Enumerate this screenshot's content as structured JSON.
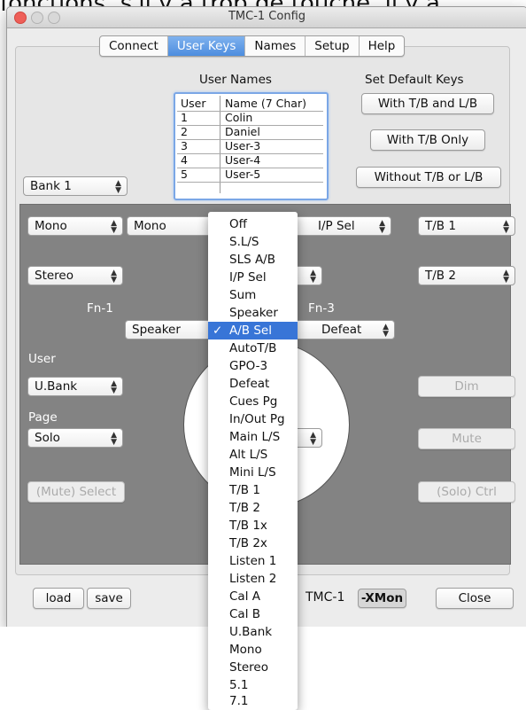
{
  "top_text": "fonctions, s'il y a trop de touche, il y a",
  "window": {
    "title": "TMC-1 Config"
  },
  "tabs": [
    {
      "label": "Connect",
      "active": false
    },
    {
      "label": "User Keys",
      "active": true
    },
    {
      "label": "Names",
      "active": false
    },
    {
      "label": "Setup",
      "active": false
    },
    {
      "label": "Help",
      "active": false
    }
  ],
  "user_names": {
    "title": "User Names",
    "col_user": "User",
    "col_name": "Name (7 Char)",
    "rows": [
      {
        "user": "1",
        "name": "Colin"
      },
      {
        "user": "2",
        "name": "Daniel"
      },
      {
        "user": "3",
        "name": "User-3"
      },
      {
        "user": "4",
        "name": "User-4"
      },
      {
        "user": "5",
        "name": "User-5"
      }
    ]
  },
  "default_keys": {
    "title": "Set Default Keys",
    "with_tb_lb": "With T/B and L/B",
    "with_tb_only": "With T/B Only",
    "without": "Without T/B or L/B"
  },
  "bank_select": "Bank 1",
  "panel": {
    "row1": [
      "Mono",
      "Mono",
      "I/P Sel",
      "T/B 1"
    ],
    "stereo": "Stereo",
    "tb2": "T/B 2",
    "fn1_label": "Fn-1",
    "fn3_label": "Fn-3",
    "fn1_value": "Speaker",
    "fn3_value": "Defeat",
    "user_label": "User",
    "user_value": "U.Bank",
    "page_label": "Page",
    "page_value": "Solo",
    "dim": "Dim",
    "mute": "Mute",
    "mute_select": "(Mute) Select",
    "solo_ctrl": "(Solo) Ctrl"
  },
  "bottom": {
    "load": "load",
    "save": "save",
    "tmc1": "TMC-1",
    "xmon": "-XMon",
    "close": "Close"
  },
  "dropdown": {
    "selected": "A/B Sel",
    "check_glyph": "✓",
    "items": [
      "Off",
      "S.L/S",
      "SLS A/B",
      "I/P Sel",
      "Sum",
      "Speaker",
      "A/B Sel",
      "AutoT/B",
      "GPO-3",
      "Defeat",
      "Cues Pg",
      "In/Out Pg",
      "Main L/S",
      "Alt L/S",
      "Mini L/S",
      "T/B 1",
      "T/B 2",
      "T/B 1x",
      "T/B 2x",
      "Listen 1",
      "Listen 2",
      "Cal A",
      "Cal B",
      "U.Bank",
      "Mono",
      "Stereo",
      "5.1",
      "7.1"
    ]
  },
  "colors": {
    "close": "#ee5f58",
    "minimize": "#f9be4b",
    "zoom": "#5fc652",
    "selection": "#3875d7",
    "panel": "#838383"
  }
}
